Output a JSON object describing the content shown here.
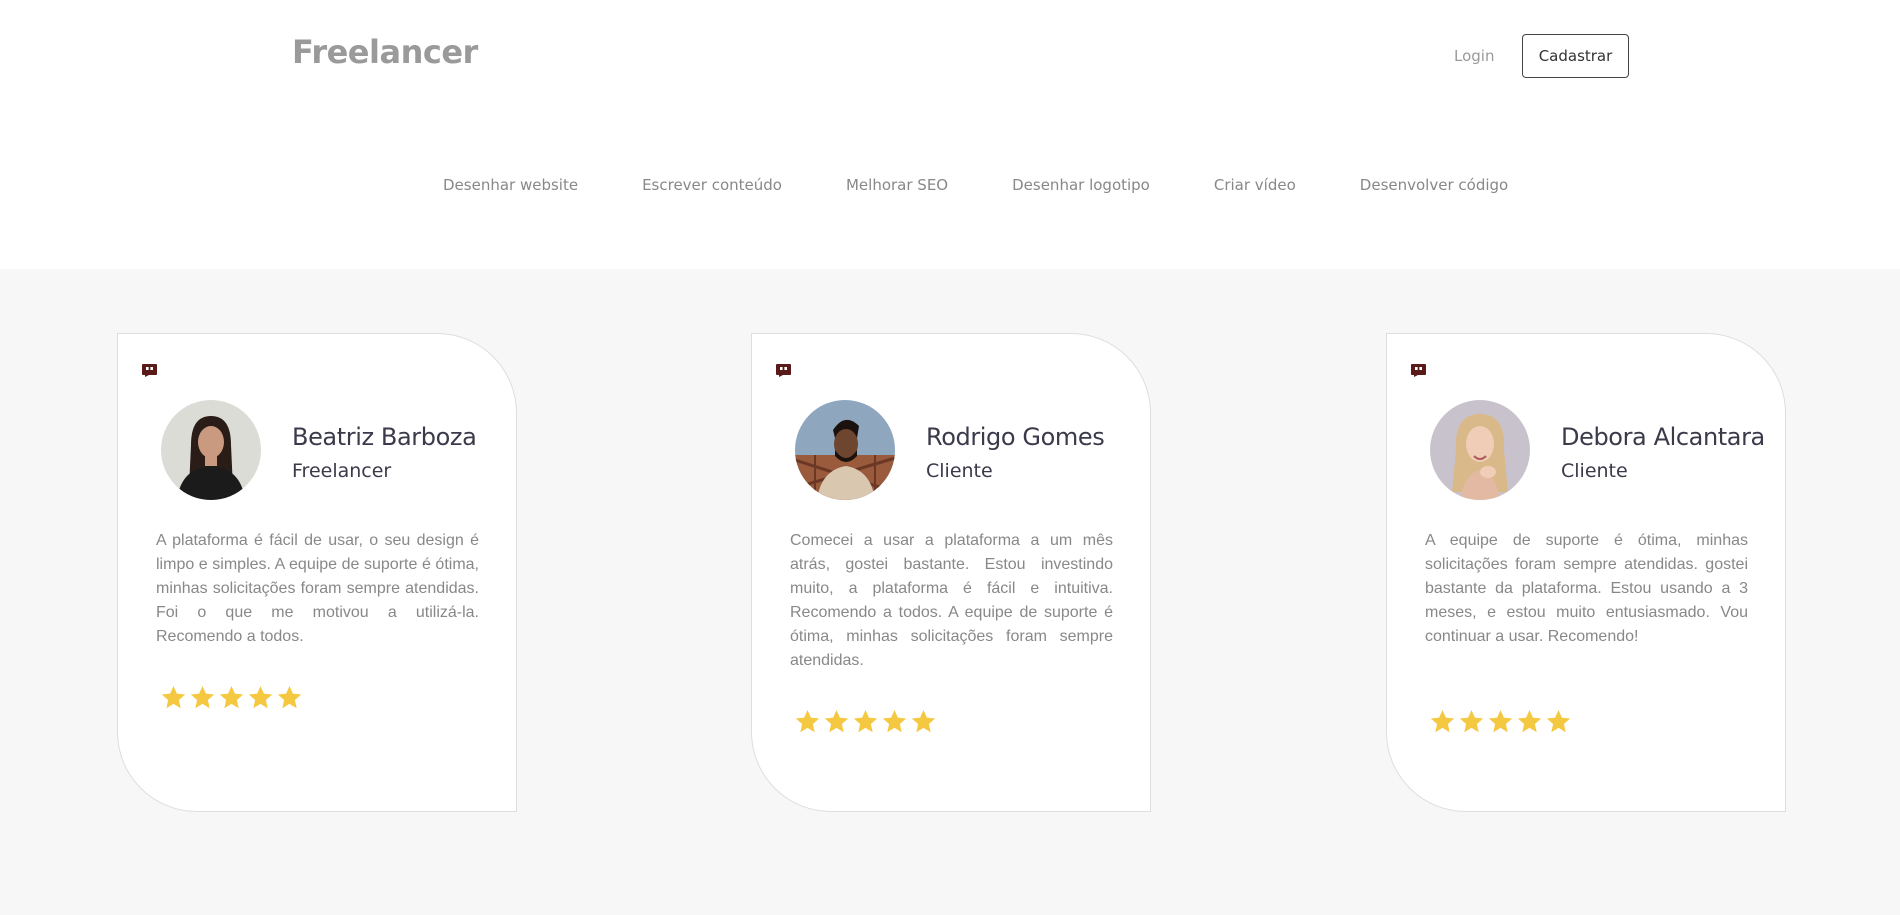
{
  "header": {
    "brand": "Freelancer",
    "login_label": "Login",
    "signup_label": "Cadastrar"
  },
  "nav": {
    "items": [
      "Desenhar website",
      "Escrever conteúdo",
      "Melhorar SEO",
      "Desenhar logotipo",
      "Criar vídeo",
      "Desenvolver código"
    ]
  },
  "colors": {
    "brand_gray": "#9a9a9a",
    "star": "#f5c842",
    "quote_icon": "#5b1a1a",
    "section_bg": "#f7f7f7"
  },
  "testimonials": [
    {
      "name": "Beatriz Barboza",
      "role": "Freelancer",
      "text": "A plataforma é fácil de usar, o seu design é limpo e simples. A equipe de suporte é ótima, minhas solicitações foram sempre atendidas. Foi o que me motivou a utilizá-la. Recomendo a todos.",
      "rating": 5,
      "icon": "quote-icon"
    },
    {
      "name": "Rodrigo Gomes",
      "role": "Cliente",
      "text": "Comecei a usar a plataforma a um mês atrás, gostei bastante. Estou investindo muito, a plataforma é fácil e intuitiva. Recomendo a todos. A equipe de suporte é ótima, minhas solicitações foram sempre atendidas.",
      "rating": 5,
      "icon": "quote-icon"
    },
    {
      "name": "Debora Alcantara",
      "role": "Cliente",
      "text": "A equipe de suporte é ótima, minhas solicitações foram sempre atendidas. gostei bastante da plataforma. Estou usando a 3 meses, e estou muito entusiasmado. Vou continuar a usar. Recomendo!",
      "rating": 5,
      "icon": "quote-icon"
    }
  ]
}
